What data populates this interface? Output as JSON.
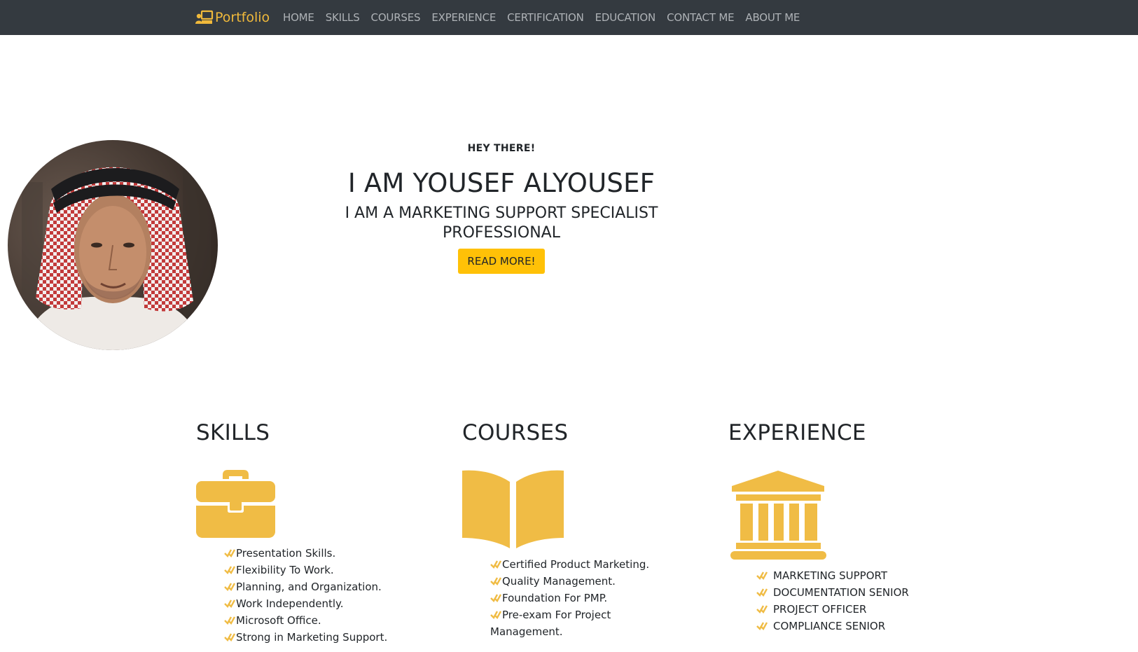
{
  "nav": {
    "brand": "Portfolio",
    "brand_icon": "presenter-board-icon",
    "links": [
      "HOME",
      "SKILLS",
      "COURSES",
      "EXPERIENCE",
      "CERTIFICATION",
      "EDUCATION",
      "CONTACT ME",
      "ABOUT ME"
    ]
  },
  "hero": {
    "greeting": "HEY THERE!",
    "name": "I AM YOUSEF ALYOUSEF",
    "subtitle": "I AM A MARKETING SUPPORT SPECIALIST PROFESSIONAL",
    "button": "READ MORE!"
  },
  "sections": {
    "skills": {
      "title": "SKILLS",
      "icon": "briefcase-icon",
      "items": [
        "Presentation Skills.",
        "Flexibility To Work.",
        "Planning, and Organization.",
        "Work Independently.",
        "Microsoft Office.",
        "Strong in Marketing Support."
      ]
    },
    "courses": {
      "title": "COURSES",
      "icon": "open-book-icon",
      "items": [
        "Certified Product Marketing.",
        "Quality Management.",
        "Foundation For PMP.",
        "Pre-exam For Project Management."
      ]
    },
    "experience": {
      "title": "EXPERIENCE",
      "icon": "institution-icon",
      "items": [
        "MARKETING SUPPORT",
        "DOCUMENTATION SENIOR",
        "PROJECT OFFICER",
        "COMPLIANCE SENIOR"
      ]
    }
  },
  "colors": {
    "navbar": "#343a40",
    "accent": "#f0bc45",
    "button": "#ffc107",
    "nav_text": "#aeb2b6"
  }
}
